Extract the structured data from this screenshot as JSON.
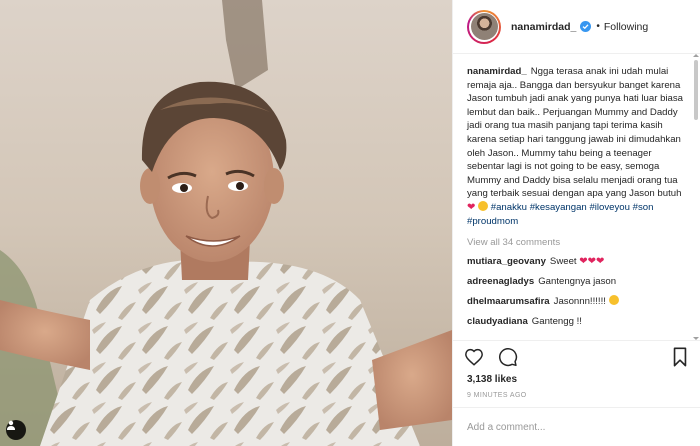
{
  "header": {
    "username": "nanamirdad_",
    "separator": "•",
    "follow_state": "Following"
  },
  "caption": {
    "username": "nanamirdad_",
    "text": "Ngga terasa anak ini udah mulai remaja aja.. Bangga dan bersyukur banget karena Jason tumbuh jadi anak yang punya hati luar biasa lembut dan baik.. Perjuangan Mummy and Daddy jadi orang tua masih panjang tapi terima kasih karena setiap hari tanggung jawab ini dimudahkan oleh Jason.. Mummy tahu being a teenager sebentar lagi is not going to be easy, semoga Mummy and Daddy bisa selalu menjadi orang tua yang terbaik sesuai dengan apa yang Jason butuh",
    "hashtags": [
      "#anakku",
      "#kesayangan",
      "#iloveyou",
      "#son",
      "#proudmom"
    ]
  },
  "view_all_comments": "View all 34 comments",
  "comments": [
    {
      "username": "mutiara_geovany",
      "text": "Sweet",
      "hearts": "❤❤❤"
    },
    {
      "username": "adreenagladys",
      "text": "Gantengnya jason",
      "hearts": ""
    },
    {
      "username": "dhelmaarumsafira",
      "text": "Jasonnn!!!!!!",
      "hearts": ""
    },
    {
      "username": "claudyadiana",
      "text": "Gantengg !!",
      "hearts": ""
    }
  ],
  "likes": "3,138 likes",
  "timestamp": "9 MINUTES AGO",
  "comment_input": {
    "placeholder": "Add a comment..."
  },
  "icons": [
    "user-tag-icon",
    "verified-icon",
    "heart-outline-icon",
    "comment-icon",
    "bookmark-icon"
  ],
  "colors": {
    "link": "#003569",
    "verified": "#3897f0",
    "muted": "#999999",
    "text": "#262626",
    "divider": "#efefef"
  }
}
